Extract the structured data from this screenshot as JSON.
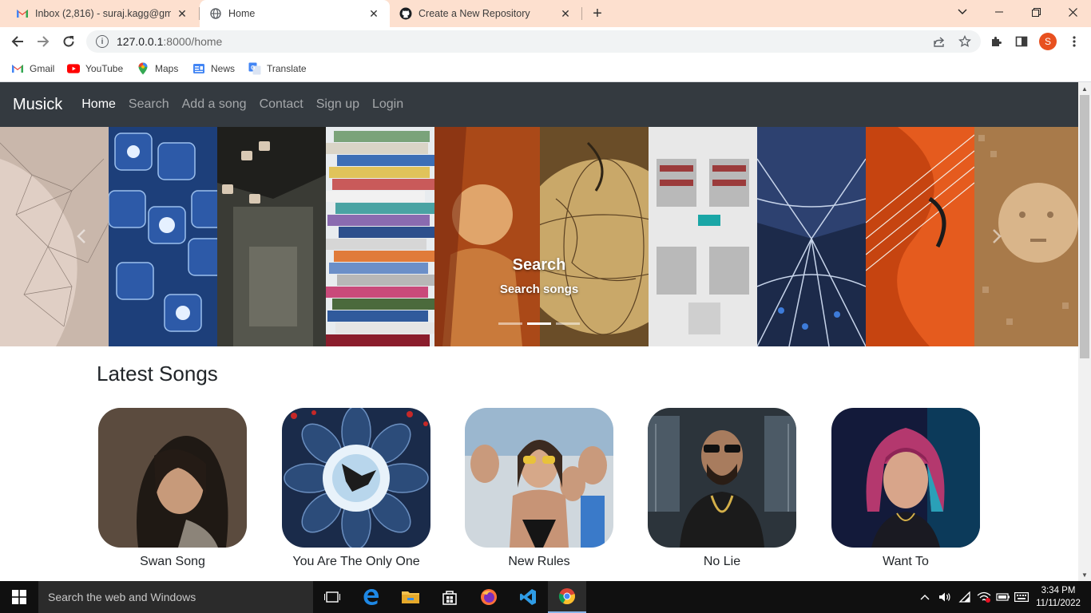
{
  "browser": {
    "tabs": [
      {
        "title": "Inbox (2,816) - suraj.kagg@gmail",
        "icon": "gmail-icon",
        "active": false
      },
      {
        "title": "Home",
        "icon": "globe-icon",
        "active": true
      },
      {
        "title": "Create a New Repository",
        "icon": "github-icon",
        "active": false
      }
    ],
    "url_host": "127.0.0.1",
    "url_path": ":8000/home",
    "profile_initial": "S",
    "bookmarks": [
      {
        "label": "Gmail",
        "icon": "gmail-icon"
      },
      {
        "label": "YouTube",
        "icon": "youtube-icon"
      },
      {
        "label": "Maps",
        "icon": "maps-icon"
      },
      {
        "label": "News",
        "icon": "news-icon"
      },
      {
        "label": "Translate",
        "icon": "translate-icon"
      }
    ]
  },
  "site": {
    "brand": "Musick",
    "nav": [
      "Home",
      "Search",
      "Add a song",
      "Contact",
      "Sign up",
      "Login"
    ],
    "carousel": {
      "title": "Search",
      "text": "Search songs",
      "slides": 3,
      "active_slide": 2
    },
    "section_title": "Latest Songs",
    "songs": [
      {
        "name": "Swan Song"
      },
      {
        "name": "You Are The Only One"
      },
      {
        "name": "New Rules"
      },
      {
        "name": "No Lie"
      },
      {
        "name": "Want To"
      }
    ]
  },
  "taskbar": {
    "search_placeholder": "Search the web and Windows",
    "time": "3:34 PM",
    "date": "11/11/2022"
  },
  "colors": {
    "tabstrip": "#fde0cf",
    "navbar": "#343a40",
    "taskbar": "#101010"
  }
}
